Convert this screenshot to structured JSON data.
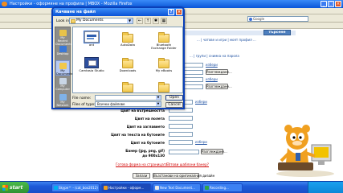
{
  "browser": {
    "title": "Настройки - оформяне на профила | MBOX - Mozilla Firefox",
    "google_placeholder": "Google"
  },
  "page": {
    "search_button": "търсене",
    "top_links": "... | чатове и игри | моят профил ...",
    "nav_links": "... | групи | снимка на парола",
    "row_links": [
      "избери",
      "избери",
      "избери",
      "избери"
    ],
    "browse_buttons": [
      "Разглеждане...",
      "Разглеждане..."
    ],
    "form_labels": [
      "Цвят на вътрешността",
      "Цвят на полета",
      "Цвят на заглавието",
      "Цвят на текста на бутоните",
      "Цвят на бутоните",
      "Банер (jpg, png, gif)",
      "до 900х130"
    ],
    "help_links": [
      "Готова форма на страницата?",
      "Готови шаблони банер?"
    ],
    "submit_button": "Запази",
    "reset_button": "Възстанови на оригиналния дизайн"
  },
  "dialog": {
    "title": "Качване на файл",
    "look_in_label": "Look in:",
    "look_in_value": "My Documents",
    "places": [
      "My Recent Documents",
      "Desktop",
      "My Documents",
      "My Computer",
      "My Network"
    ],
    "files": [
      "ant",
      "AutoData",
      "Bluetooth Exchange Folder",
      "Camtasia Studio",
      "Downloads",
      "My eBooks",
      "",
      "",
      ""
    ],
    "file_name_label": "File name:",
    "file_type_label": "Files of type:",
    "file_type_value": "Всички файлове",
    "open_button": "Open",
    "cancel_button": "Cancel"
  },
  "taskbar": {
    "start_label": "start",
    "buttons": [
      "Skype™ - (cat_box2012)",
      "Настройки - оформ...",
      "New Text Document...",
      "Recording..."
    ]
  }
}
